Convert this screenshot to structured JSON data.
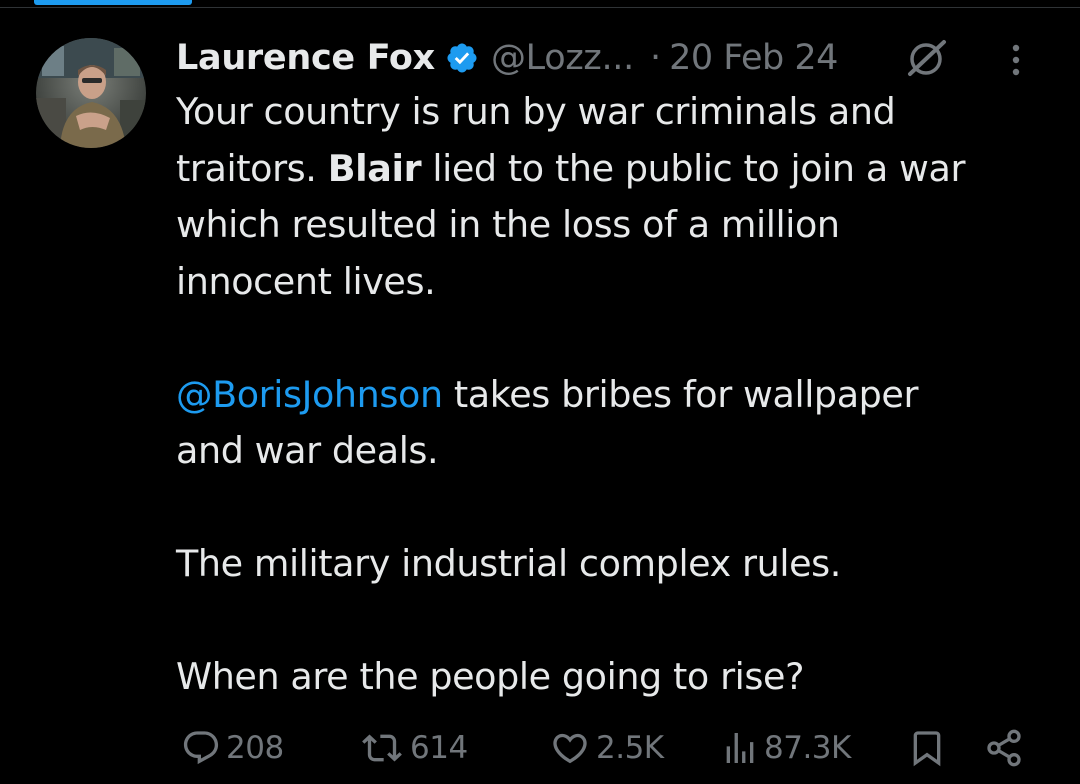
{
  "tweet": {
    "author_name": "Laurence Fox",
    "handle": "@Lozz...",
    "separator": "·",
    "date": "20 Feb 24",
    "paragraphs": [
      {
        "line1": "Your country is run by war criminals and",
        "line2_prefix": "traitors. ",
        "bold": "Blair",
        "line2_rest": " lied to the public to join a war",
        "line3": "which resulted in the loss of a million",
        "line4": "innocent lives."
      },
      {
        "mention": "@BorisJohnson",
        "line1_rest": " takes bribes for wallpaper",
        "line2": "and war deals."
      },
      {
        "line1": "The military industrial complex rules."
      },
      {
        "line1": "When are the people going to rise?"
      }
    ]
  },
  "actions": {
    "replies": "208",
    "reposts": "614",
    "likes": "2.5K",
    "views": "87.3K"
  },
  "icons": {
    "verified": "verified-badge-icon",
    "grok": "grok-icon",
    "more": "more-icon",
    "reply": "reply-icon",
    "repost": "repost-icon",
    "like": "like-icon",
    "views": "views-icon",
    "bookmark": "bookmark-icon",
    "share": "share-icon"
  },
  "colors": {
    "background": "#000000",
    "text": "#e7e9ea",
    "muted": "#71767b",
    "accent": "#1d9bf0"
  }
}
